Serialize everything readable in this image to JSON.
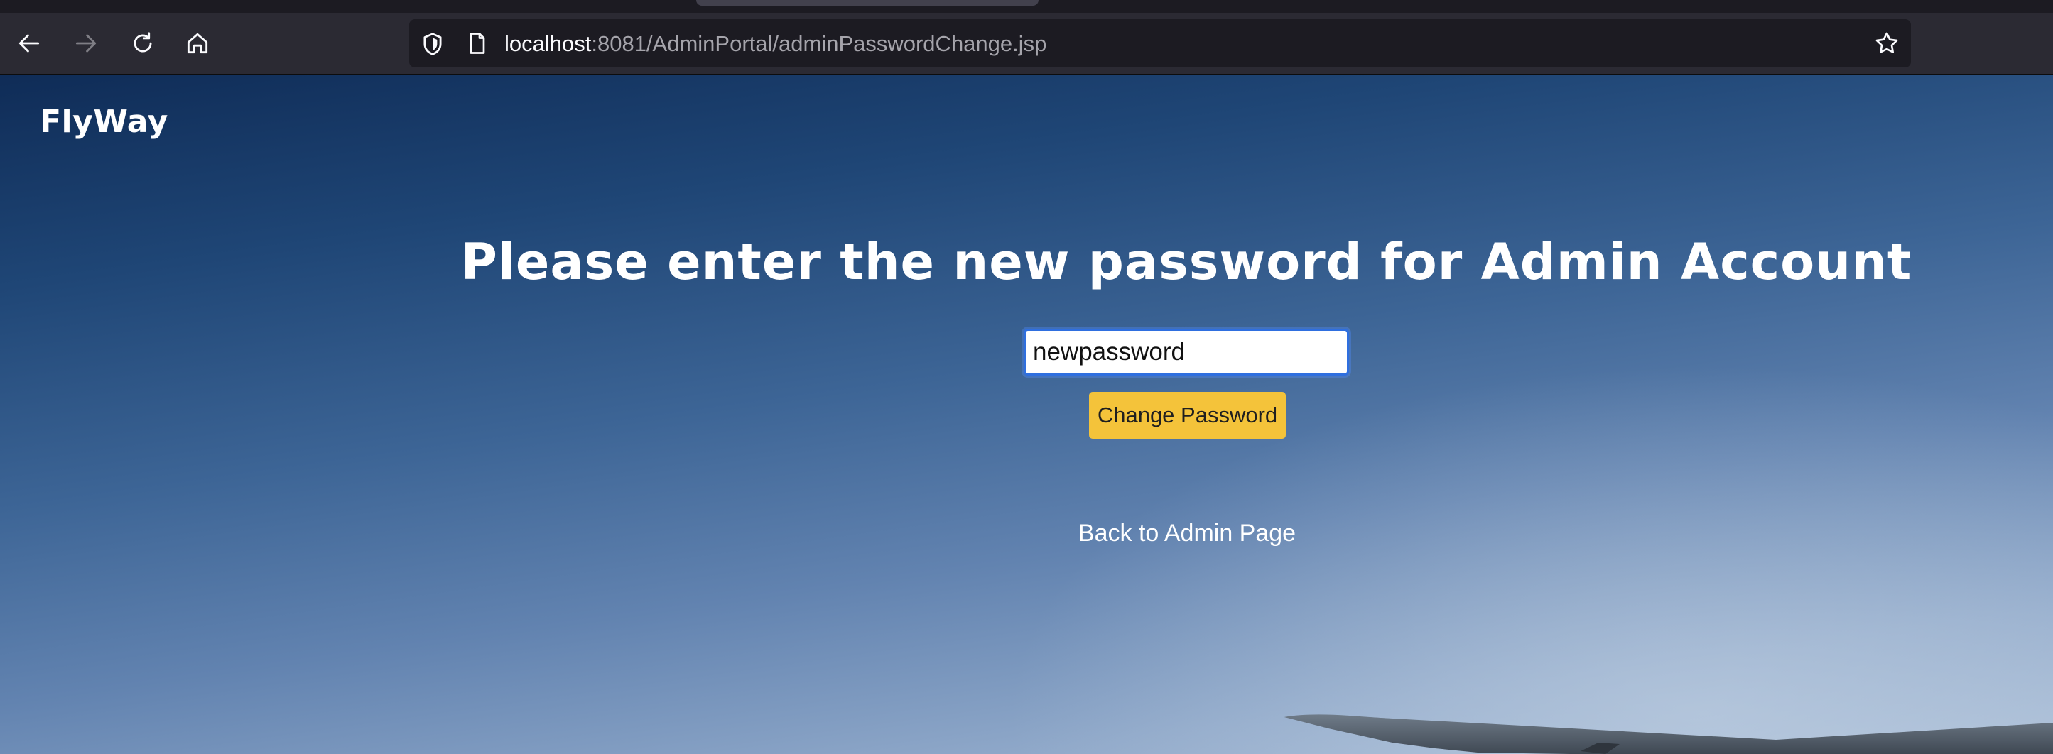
{
  "browser": {
    "url_host": "localhost",
    "url_rest": ":8081/AdminPortal/adminPasswordChange.jsp",
    "icons": {
      "back": "back-arrow-icon",
      "forward": "forward-arrow-icon",
      "reload": "reload-icon",
      "home": "home-icon",
      "shield": "tracking-protection-shield-icon",
      "page": "page-info-icon",
      "bookmark": "bookmark-star-icon"
    }
  },
  "page": {
    "brand": "FlyWay",
    "heading": "Please enter the new password for Admin Account",
    "password_value": "newpassword",
    "change_button_label": "Change Password",
    "back_link_label": "Back to Admin Page"
  },
  "colors": {
    "button": "#f4c33a",
    "input_focus_border": "#2f6fdf",
    "sky_top": "#0f2c57",
    "sky_bottom": "#a9bdd6"
  }
}
